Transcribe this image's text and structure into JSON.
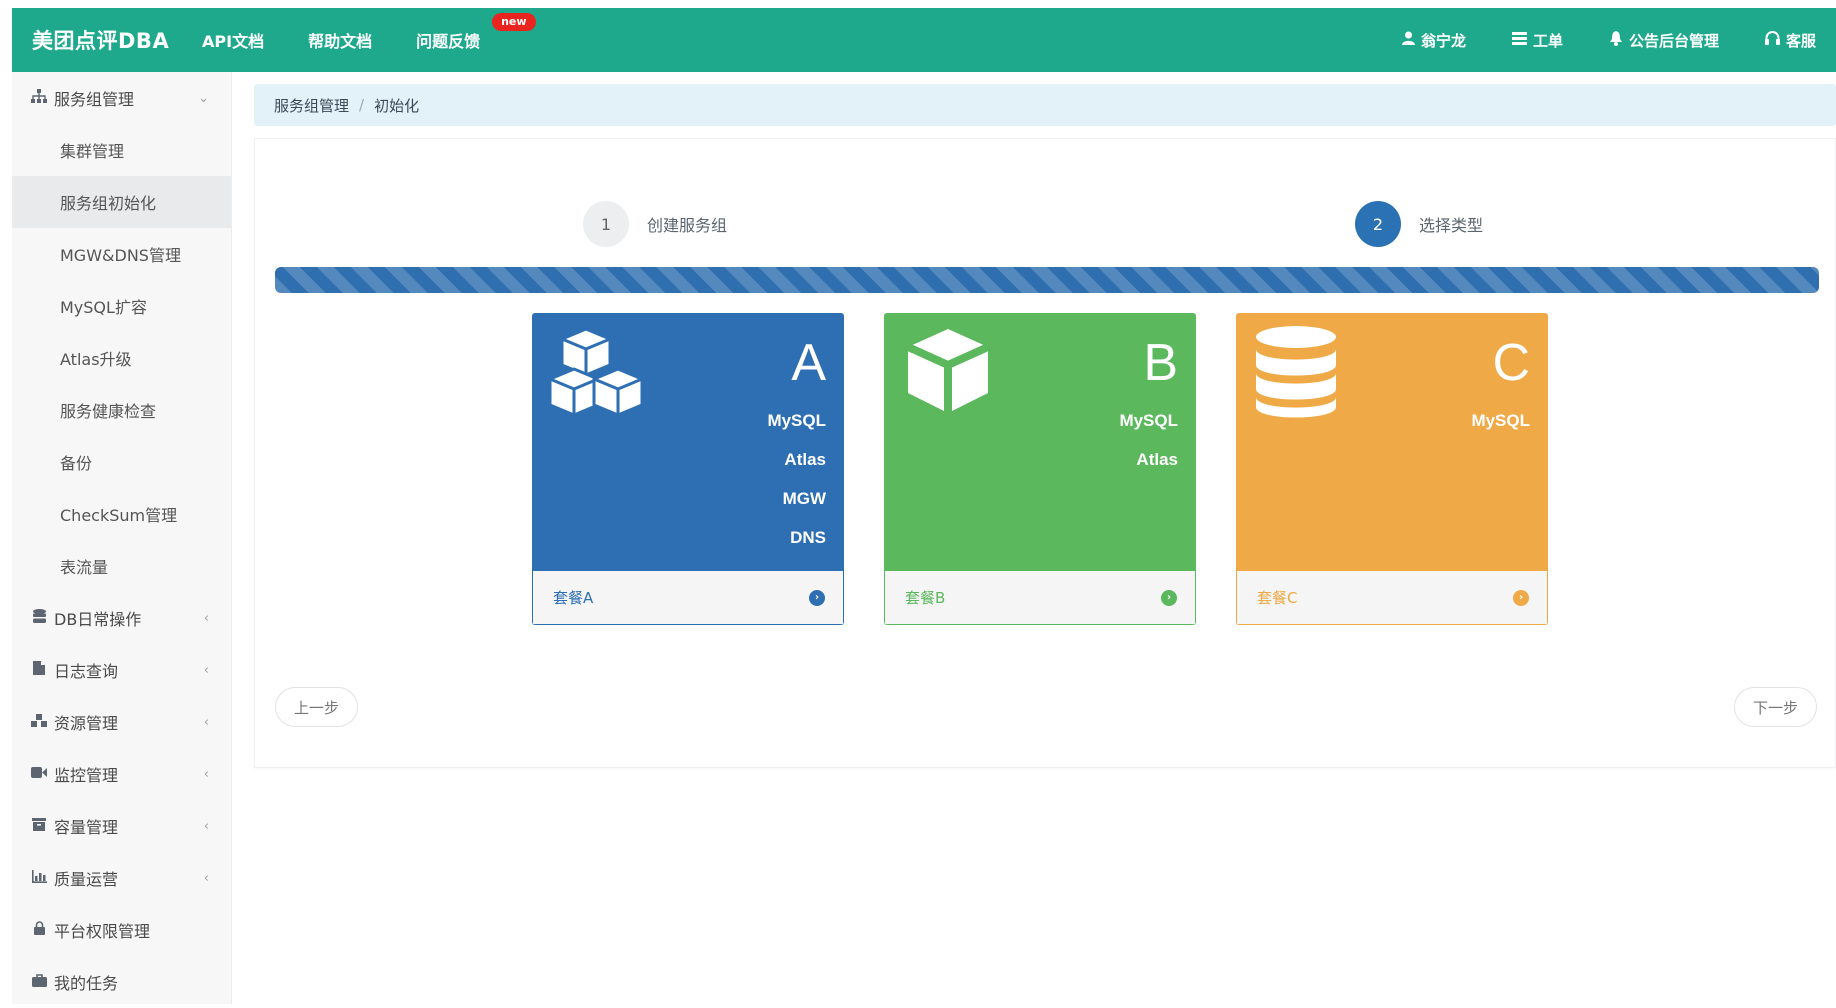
{
  "navbar": {
    "brand": "美团点评DBA",
    "links": [
      {
        "label": "API文档"
      },
      {
        "label": "帮助文档"
      },
      {
        "label": "问题反馈",
        "badge": "new"
      }
    ],
    "right": [
      {
        "label": "翁宁龙",
        "icon": "user-icon"
      },
      {
        "label": "工单",
        "icon": "list-icon"
      },
      {
        "label": "公告后台管理",
        "icon": "bell-icon"
      },
      {
        "label": "客服",
        "icon": "headset-icon"
      }
    ]
  },
  "sidebar": {
    "group_main": {
      "label": "服务组管理",
      "icon": "sitemap-icon"
    },
    "sub_items": [
      {
        "label": "集群管理"
      },
      {
        "label": "服务组初始化"
      },
      {
        "label": "MGW&DNS管理"
      },
      {
        "label": "MySQL扩容"
      },
      {
        "label": "Atlas升级"
      },
      {
        "label": "服务健康检查"
      },
      {
        "label": "备份"
      },
      {
        "label": "CheckSum管理"
      },
      {
        "label": "表流量"
      }
    ],
    "groups": [
      {
        "label": "DB日常操作",
        "icon": "database-icon"
      },
      {
        "label": "日志查询",
        "icon": "file-icon"
      },
      {
        "label": "资源管理",
        "icon": "cubes-icon"
      },
      {
        "label": "监控管理",
        "icon": "video-icon"
      },
      {
        "label": "容量管理",
        "icon": "archive-icon"
      },
      {
        "label": "质量运营",
        "icon": "bar-chart-icon"
      },
      {
        "label": "平台权限管理",
        "icon": "lock-icon"
      },
      {
        "label": "我的任务",
        "icon": "briefcase-icon"
      }
    ]
  },
  "breadcrumb": {
    "parent": "服务组管理",
    "separator": "/",
    "current": "初始化"
  },
  "steps": [
    {
      "number": "1",
      "label": "创建服务组"
    },
    {
      "number": "2",
      "label": "选择类型"
    }
  ],
  "progress": {
    "percent": 100
  },
  "cards": [
    {
      "letter": "A",
      "features": [
        "MySQL",
        "Atlas",
        "MGW",
        "DNS"
      ],
      "footer": "套餐A",
      "color": "#2e6fb3"
    },
    {
      "letter": "B",
      "features": [
        "MySQL",
        "Atlas"
      ],
      "footer": "套餐B",
      "color": "#5bb85c"
    },
    {
      "letter": "C",
      "features": [
        "MySQL"
      ],
      "footer": "套餐C",
      "color": "#efa946"
    }
  ],
  "buttons": {
    "prev": "上一步",
    "next": "下一步"
  }
}
